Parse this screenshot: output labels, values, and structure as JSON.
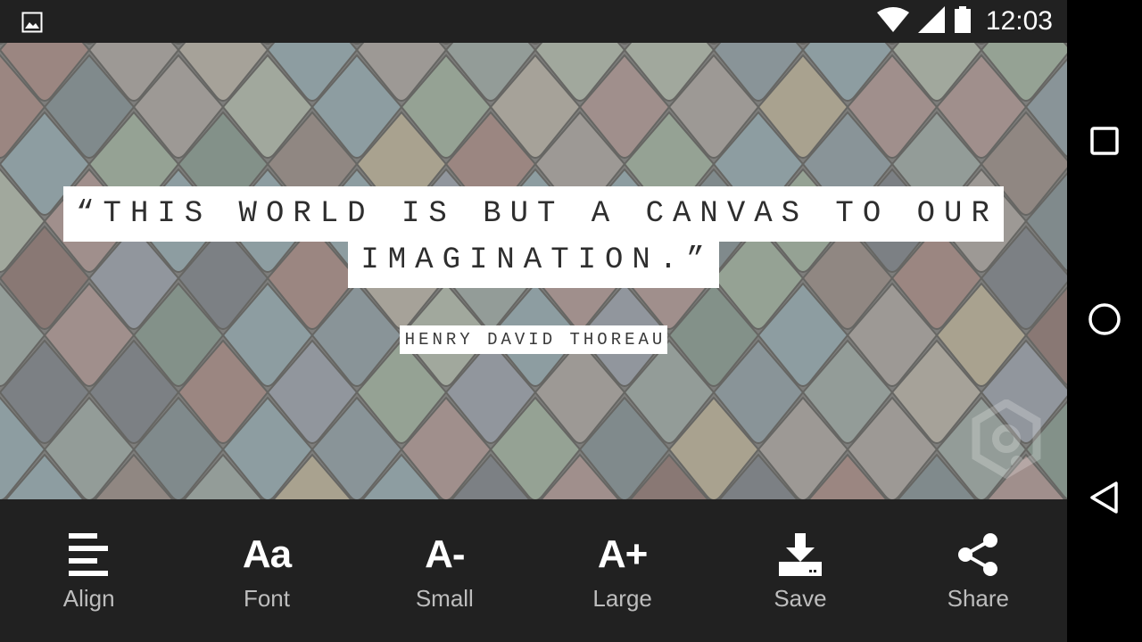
{
  "status_bar": {
    "time": "12:03",
    "icons": [
      "gallery-notification-icon",
      "wifi-icon",
      "cellular-signal-icon",
      "battery-icon"
    ]
  },
  "quote": {
    "line1": "“THIS WORLD IS BUT A CANVAS TO OUR",
    "line2": "IMAGINATION.”",
    "author": "HENRY DAVID THOREAU"
  },
  "toolbar": {
    "align": {
      "label": "Align",
      "icon": "align-left-icon"
    },
    "font": {
      "label": "Font",
      "glyph": "Aa",
      "icon": "font-icon"
    },
    "small": {
      "label": "Small",
      "glyph": "A-",
      "icon": "decrease-text-size-icon"
    },
    "large": {
      "label": "Large",
      "glyph": "A+",
      "icon": "increase-text-size-icon"
    },
    "save": {
      "label": "Save",
      "icon": "download-icon"
    },
    "share": {
      "label": "Share",
      "icon": "share-icon"
    }
  },
  "nav_bar": {
    "icons": [
      "recents-square-icon",
      "home-circle-icon",
      "back-triangle-icon"
    ]
  },
  "colors": {
    "bar_background": "#212121",
    "label_gray": "#bdbdbd"
  }
}
